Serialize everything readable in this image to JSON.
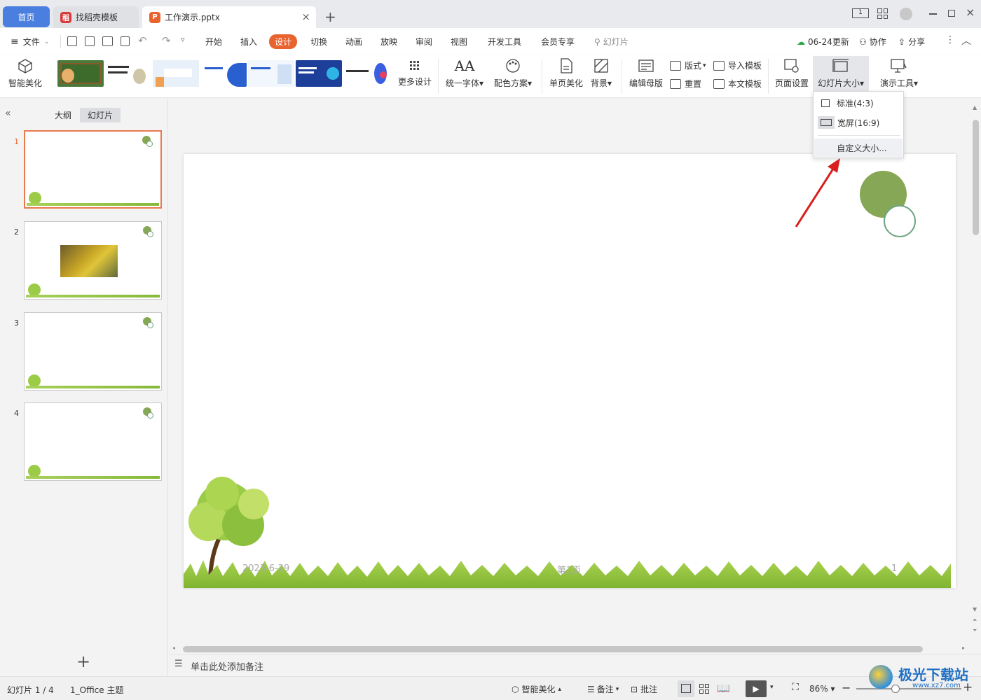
{
  "tabs": {
    "home": "首页",
    "daoke": "找稻壳模板",
    "file": "工作演示.pptx",
    "new_tab": "+",
    "close": "×"
  },
  "menu": {
    "file": "文件",
    "items": [
      "开始",
      "插入",
      "设计",
      "切换",
      "动画",
      "放映",
      "审阅",
      "视图",
      "开发工具",
      "会员专享"
    ],
    "search_placeholder": "幻灯片",
    "update": "06-24更新",
    "collab": "协作",
    "share": "分享"
  },
  "ribbon": {
    "smart_beautify": "智能美化",
    "more_design": "更多设计",
    "unify_font": "统一字体",
    "color_scheme": "配色方案",
    "single_page_beautify": "单页美化",
    "background": "背景",
    "edit_master": "编辑母版",
    "layout": "版式",
    "reset": "重置",
    "import_template": "导入模板",
    "text_template": "本文模板",
    "page_setup": "页面设置",
    "slide_size": "幻灯片大小",
    "present_tools": "演示工具"
  },
  "dropdown": {
    "standard": "标准(4:3)",
    "widescreen": "宽屏(16:9)",
    "custom": "自定义大小..."
  },
  "left_panel": {
    "outline": "大纲",
    "slides": "幻灯片",
    "slide_numbers": [
      "1",
      "2",
      "3",
      "4"
    ],
    "add": "+"
  },
  "slide": {
    "date": "2023-6-29",
    "page_label": "第1页",
    "page_number": "1"
  },
  "notes_placeholder": "单击此处添加备注",
  "status": {
    "slide_count": "幻灯片 1 / 4",
    "theme": "1_Office 主题",
    "smart_beautify": "智能美化",
    "notes": "备注",
    "comments": "批注",
    "zoom": "86%"
  },
  "watermark": "极光下载站",
  "watermark_url": "www.xz7.com",
  "colors": {
    "accent": "#e9632f",
    "home_tab": "#4a7fe0",
    "slide_circle": "#86a755",
    "selected_thumb": "#e9794f"
  }
}
